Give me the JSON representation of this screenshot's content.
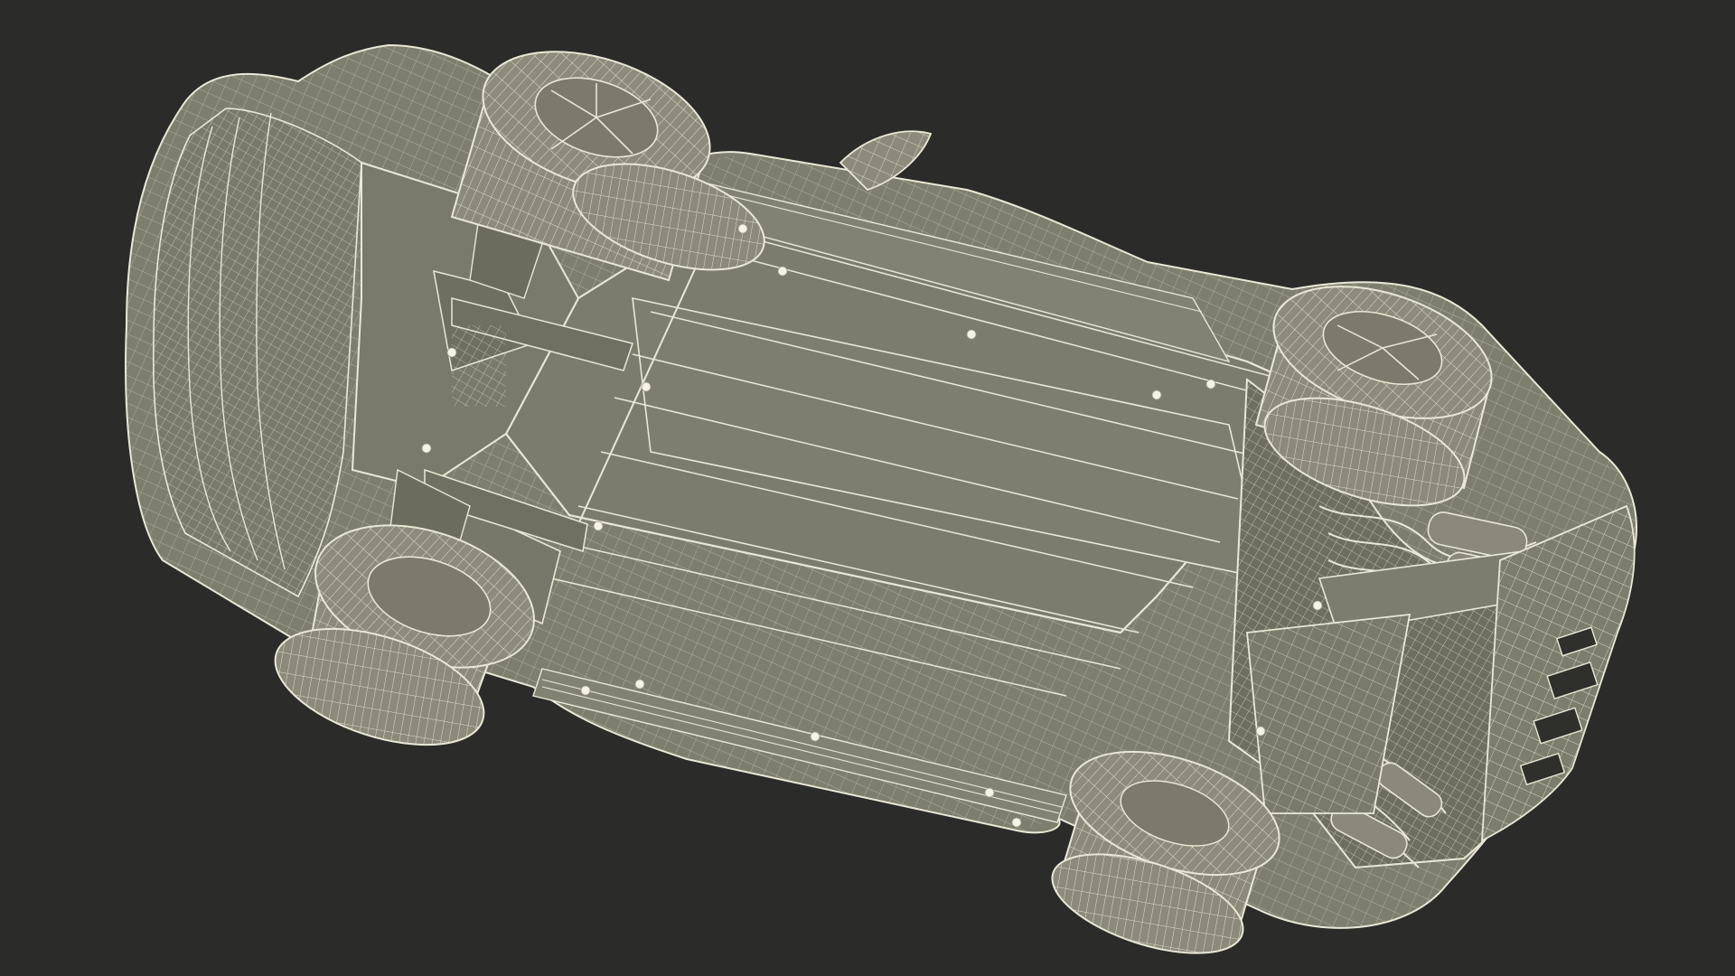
{
  "scene": {
    "subject": "car-underside-wireframe",
    "colors": {
      "background": "#2b2b29",
      "surface": "#7e7e6f",
      "surface_dark": "#6b6b5e",
      "wire": "#e9e8d6",
      "wire_dim": "#c9c8b4",
      "bolt": "#f4f3e6",
      "tire_wall": "#8b8a7b",
      "cavity": "#55554b"
    }
  }
}
